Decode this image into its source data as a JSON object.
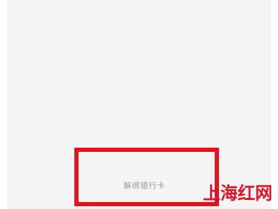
{
  "unbind_card": {
    "label": "解绑银行卡"
  },
  "annotation": {
    "highlight_color": "#e8101c"
  },
  "watermark": {
    "text": "上海红网",
    "color": "#dc1428"
  }
}
